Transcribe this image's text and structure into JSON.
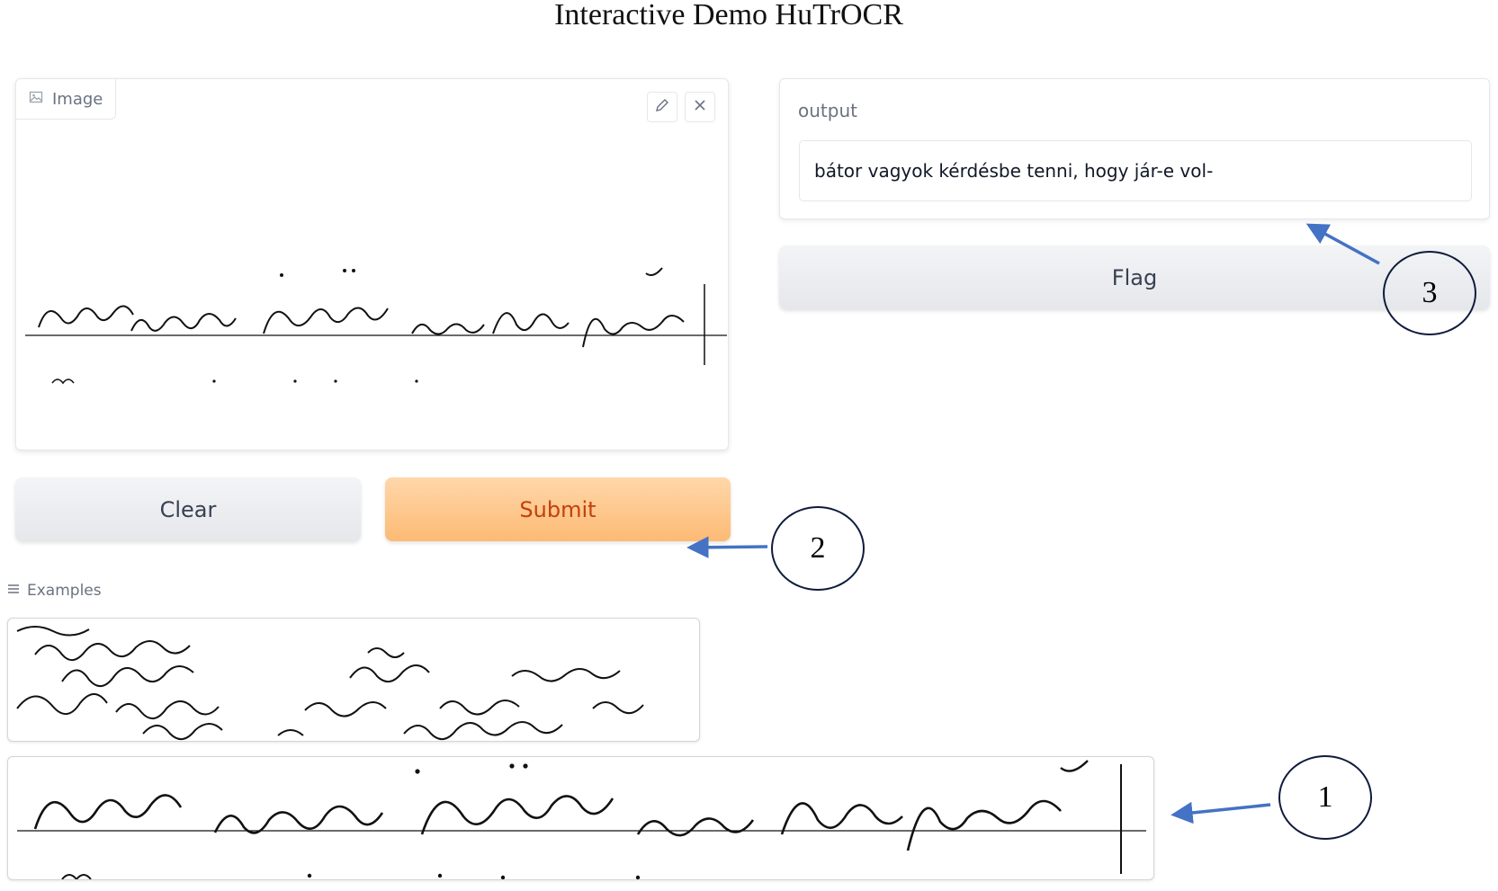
{
  "page": {
    "title": "Interactive Demo HuTrOCR"
  },
  "image_input": {
    "tab_label": "Image",
    "tab_icon": "image-icon",
    "edit_icon": "pencil-icon",
    "close_icon": "close-icon"
  },
  "buttons": {
    "clear": "Clear",
    "submit": "Submit",
    "flag": "Flag"
  },
  "output": {
    "label": "output",
    "value": "bátor vagyok kérdésbe tenni, hogy jár-e vol-"
  },
  "examples": {
    "label": "Examples",
    "icon": "list-icon"
  },
  "annotations": [
    "1",
    "2",
    "3"
  ],
  "colors": {
    "submit_bg": "#fdba74",
    "submit_text": "#c2410c",
    "annotation_arrow": "#4472c4",
    "annotation_circle": "#0f1b3d"
  }
}
